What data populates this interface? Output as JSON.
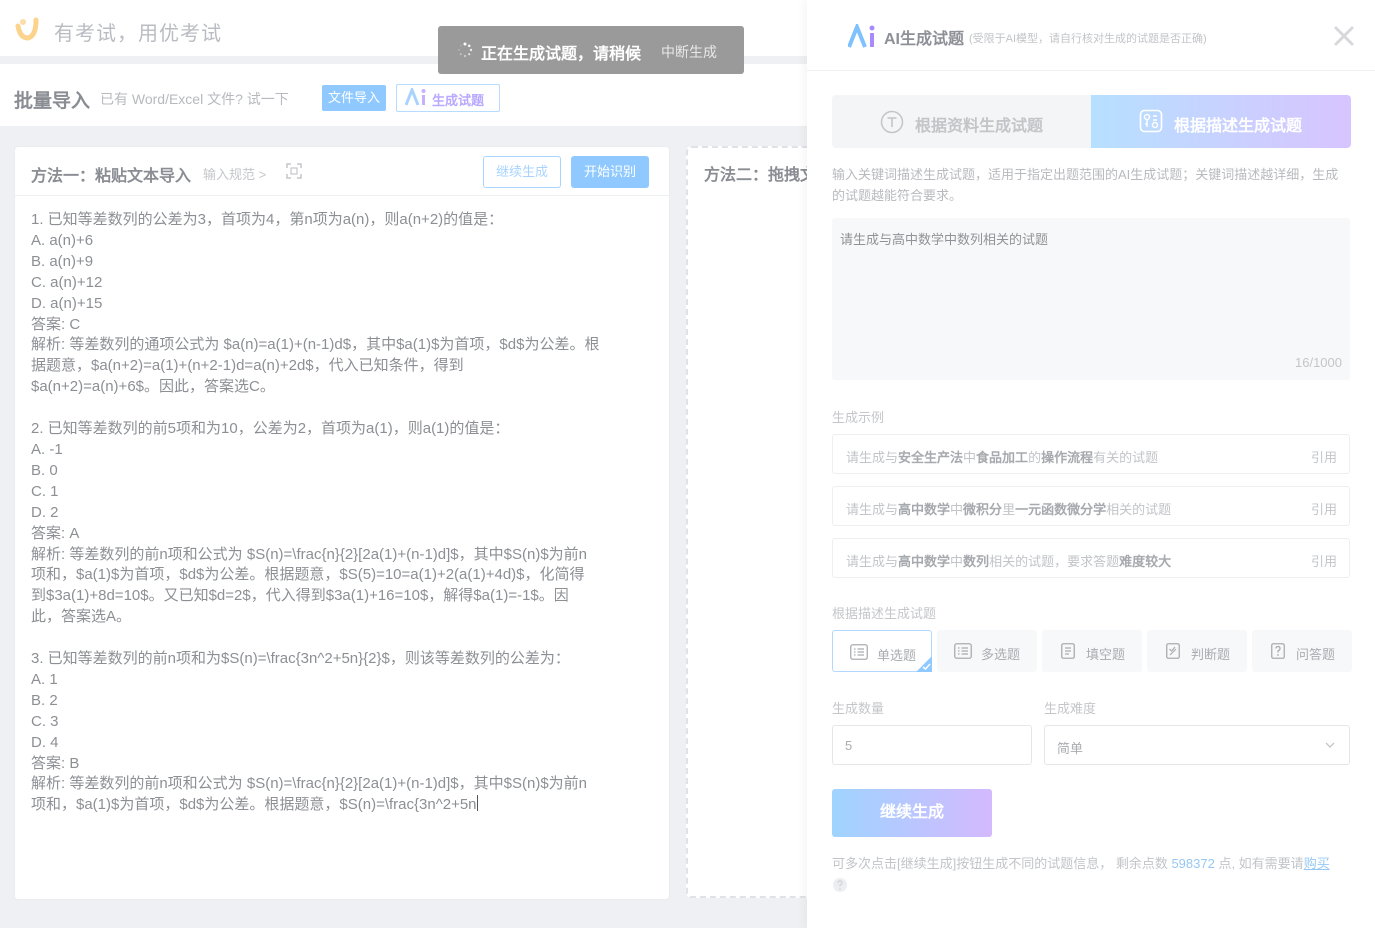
{
  "app": {
    "brand": "有考试，用优考试"
  },
  "toast": {
    "text": "正在生成试题，请稍候",
    "stop": "中断生成"
  },
  "import": {
    "title": "批量导入",
    "hint": "已有 Word/Excel 文件? 试一下",
    "file_btn": "文件导入",
    "ai_btn": "生成试题"
  },
  "method1": {
    "title": "方法一：粘贴文本导入",
    "spec": "输入规范 >",
    "continue_btn": "继续生成",
    "recognize_btn": "开始识别",
    "content": "1. 已知等差数列的公差为3，首项为4，第n项为a(n)，则a(n+2)的值是：\nA. a(n)+6\nB. a(n)+9\nC. a(n)+12\nD. a(n)+15\n答案: C\n解析: 等差数列的通项公式为 $a(n)=a(1)+(n-1)d$，其中$a(1)$为首项，$d$为公差。根\n据题意，$a(n+2)=a(1)+(n+2-1)d=a(n)+2d$，代入已知条件，得到\n$a(n+2)=a(n)+6$。因此，答案选C。\n\n2. 已知等差数列的前5项和为10，公差为2，首项为a(1)，则a(1)的值是：\nA. -1\nB. 0\nC. 1\nD. 2\n答案: A\n解析: 等差数列的前n项和公式为 $S(n)=\\frac{n}{2}[2a(1)+(n-1)d]$，其中$S(n)$为前n\n项和，$a(1)$为首项，$d$为公差。根据题意，$S(5)=10=a(1)+2(a(1)+4d)$，化简得\n到$3a(1)+8d=10$。又已知$d=2$，代入得到$3a(1)+16=10$，解得$a(1)=-1$。因\n此，答案选A。\n\n3. 已知等差数列的前n项和为$S(n)=\\frac{3n^2+5n}{2}$，则该等差数列的公差为：\nA. 1\nB. 2\nC. 3\nD. 4\n答案: B\n解析: 等差数列的前n项和公式为 $S(n)=\\frac{n}{2}[2a(1)+(n-1)d]$，其中$S(n)$为前n\n项和，$a(1)$为首项，$d$为公差。根据题意，$S(n)=\\frac{3n^2+5n"
  },
  "method2": {
    "title": "方法二：拖拽文"
  },
  "drawer": {
    "title": "AI生成试题",
    "subtitle": "(受限于AI模型，请自行核对生成的试题是否正确)",
    "tab_material": "根据资料生成试题",
    "tab_description": "根据描述生成试题",
    "description": "输入关键词描述生成试题，适用于指定出题范围的AI生成试题；关键词描述越详细，生成的试题越能符合要求。",
    "prompt": "请生成与高中数学中数列相关的试题",
    "prompt_count": "16/1000",
    "examples_label": "生成示例",
    "examples": [
      {
        "parts": [
          "请生成与",
          "安全生产法",
          "中",
          "食品加工",
          "的",
          "操作流程",
          "有关的试题"
        ],
        "use": "引用"
      },
      {
        "parts": [
          "请生成与",
          "高中数学",
          "中",
          "微积分",
          "里",
          "一元函数微分学",
          "相关的试题"
        ],
        "use": "引用"
      },
      {
        "parts": [
          "请生成与",
          "高中数学",
          "中",
          "数列",
          "相关的试题，要求",
          "答题",
          "难度较大"
        ],
        "use": "引用"
      }
    ],
    "qtype_label": "根据描述生成试题",
    "qtypes": [
      "单选题",
      "多选题",
      "填空题",
      "判断题",
      "问答题"
    ],
    "count_label": "生成数量",
    "count_value": "5",
    "difficulty_label": "生成难度",
    "difficulty_value": "简单",
    "generate_btn": "继续生成",
    "footer_text": "可多次点击[继续生成]按钮生成不同的试题信息， 剩余点数 ",
    "points": "598372",
    "footer_text2": " 点, 如有需要请",
    "buy": "购买"
  },
  "colors": {
    "accent": "#8fc9ff",
    "ai_gradient_start": "#b6e0ff",
    "ai_gradient_end": "#d8c4ff"
  }
}
